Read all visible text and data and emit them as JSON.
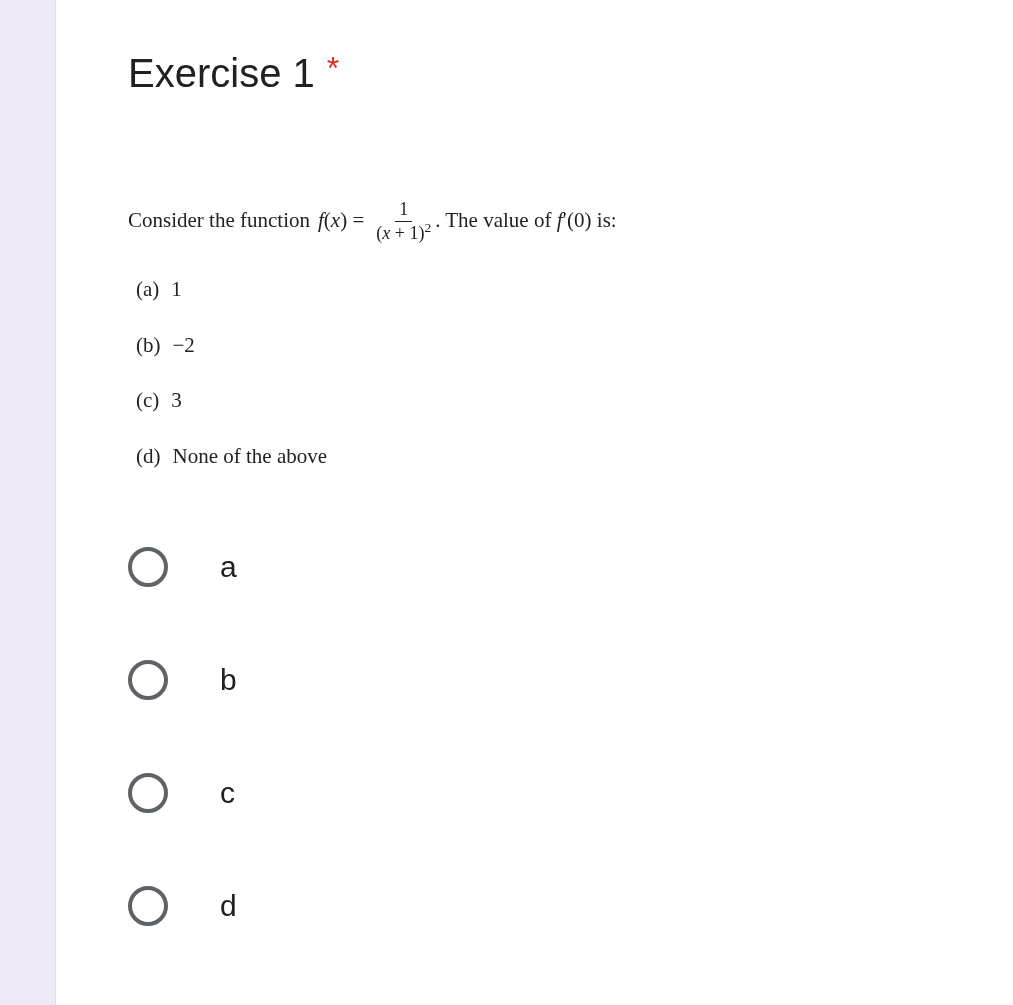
{
  "question": {
    "title": "Exercise 1",
    "required_mark": "*"
  },
  "image": {
    "intro": "Consider the function",
    "lhs": "*f*(*x*) =",
    "numerator": "1",
    "denominator": "(*x* + 1)$^{2}$",
    "rest": ". The value of *f*′(0) is:",
    "choices": [
      {
        "label": "(a)",
        "text": "1"
      },
      {
        "label": "(b)",
        "text": "−2"
      },
      {
        "label": "(c)",
        "text": "3"
      },
      {
        "label": "(d)",
        "text": "None of the above"
      }
    ]
  },
  "options": [
    {
      "label": "a",
      "selected": false
    },
    {
      "label": "b",
      "selected": false
    },
    {
      "label": "c",
      "selected": false
    },
    {
      "label": "d",
      "selected": false
    }
  ]
}
